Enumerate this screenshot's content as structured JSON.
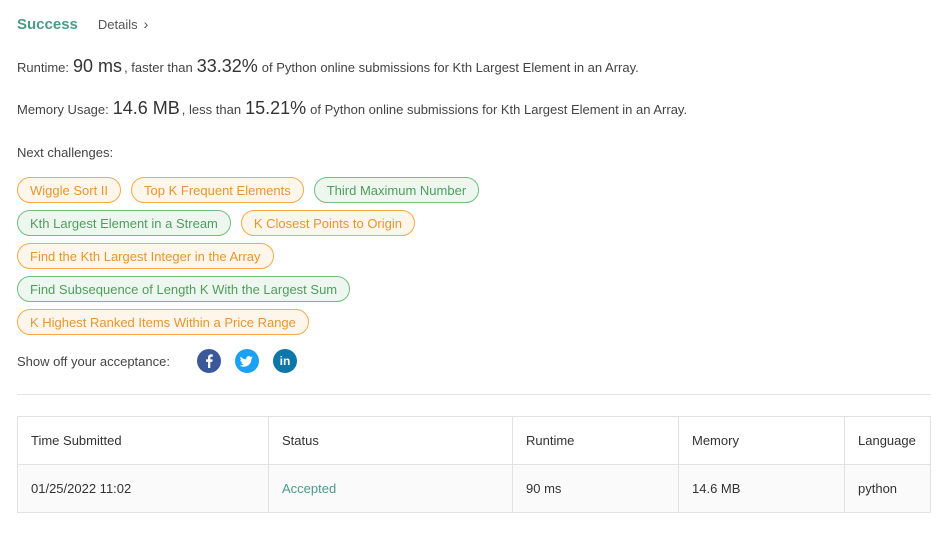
{
  "header": {
    "status": "Success",
    "details_label": "Details",
    "chevron": "›"
  },
  "runtime": {
    "label": "Runtime:",
    "value": "90 ms",
    "mid_text": ", faster than",
    "percent": "33.32%",
    "suffix": "of Python online submissions for Kth Largest Element in an Array."
  },
  "memory": {
    "label": "Memory Usage:",
    "value": "14.6 MB",
    "mid_text": ", less than",
    "percent": "15.21%",
    "suffix": "of Python online submissions for Kth Largest Element in an Array."
  },
  "next_challenges": {
    "label": "Next challenges:",
    "rows": [
      [
        {
          "title": "Wiggle Sort II",
          "difficulty": "medium"
        },
        {
          "title": "Top K Frequent Elements",
          "difficulty": "medium"
        },
        {
          "title": "Third Maximum Number",
          "difficulty": "easy"
        }
      ],
      [
        {
          "title": "Kth Largest Element in a Stream",
          "difficulty": "easy"
        },
        {
          "title": "K Closest Points to Origin",
          "difficulty": "medium"
        }
      ],
      [
        {
          "title": "Find the Kth Largest Integer in the Array",
          "difficulty": "medium"
        }
      ],
      [
        {
          "title": "Find Subsequence of Length K With the Largest Sum",
          "difficulty": "easy"
        }
      ],
      [
        {
          "title": "K Highest Ranked Items Within a Price Range",
          "difficulty": "medium"
        }
      ]
    ]
  },
  "share": {
    "label": "Show off your acceptance:",
    "buttons": [
      {
        "icon": "facebook-icon",
        "glyph": "f"
      },
      {
        "icon": "twitter-icon",
        "glyph": "t"
      },
      {
        "icon": "linkedin-icon",
        "glyph": "in"
      }
    ]
  },
  "submissions": {
    "headers": [
      "Time Submitted",
      "Status",
      "Runtime",
      "Memory",
      "Language"
    ],
    "rows": [
      {
        "time": "01/25/2022 11:02",
        "status": "Accepted",
        "runtime": "90 ms",
        "memory": "14.6 MB",
        "language": "python"
      }
    ]
  },
  "colors": {
    "success": "#4a9c88",
    "medium_border": "#f5a94a",
    "medium_text": "#e8962e",
    "easy_border": "#6ec07c",
    "easy_text": "#4f9d5d",
    "facebook": "#3b5998",
    "twitter": "#1da1f2",
    "linkedin": "#0e76a8"
  }
}
